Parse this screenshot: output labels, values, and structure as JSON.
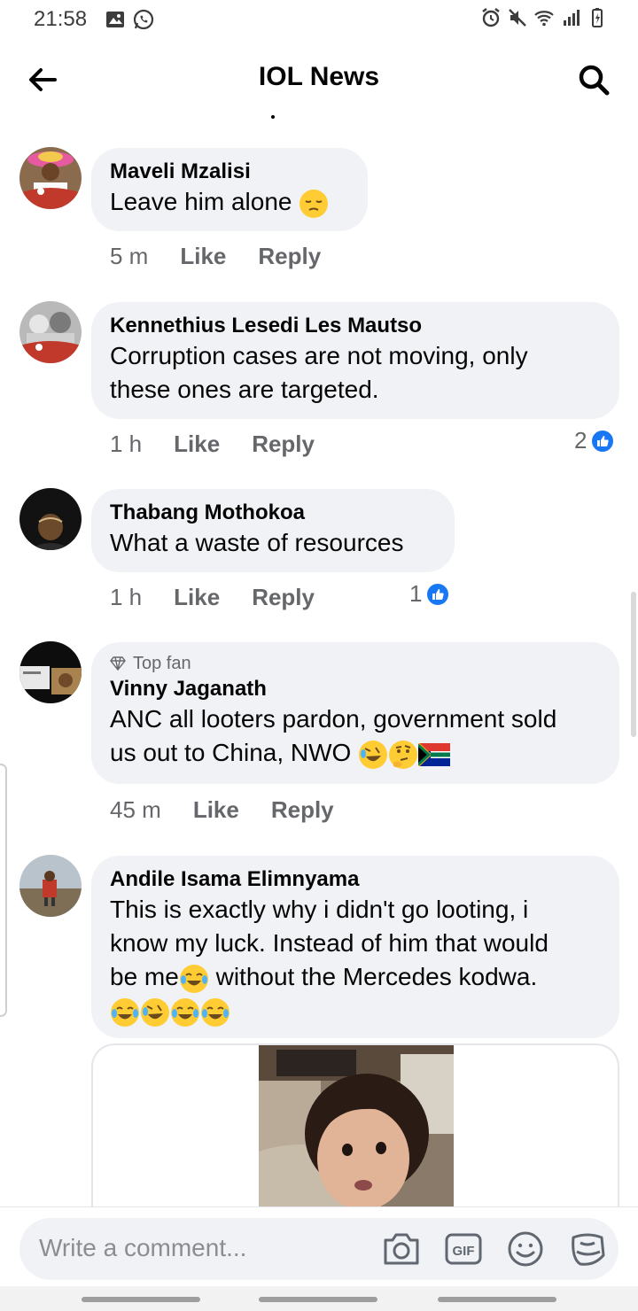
{
  "status_bar": {
    "time": "21:58"
  },
  "header": {
    "title": "IOL News"
  },
  "comments": [
    {
      "author": "Maveli Mzalisi",
      "text": "Leave him alone",
      "time": "5 m",
      "like": "Like",
      "reply": "Reply"
    },
    {
      "author": "Kennethius Lesedi Les Mautso",
      "text_line1": "Corruption cases are not moving, only",
      "text_line2": "these ones are targeted.",
      "time": "1 h",
      "like": "Like",
      "reply": "Reply",
      "reactions": "2"
    },
    {
      "author": "Thabang Mothokoa",
      "text": "What a waste of resources",
      "time": "1 h",
      "like": "Like",
      "reply": "Reply",
      "reactions": "1"
    },
    {
      "badge": "Top fan",
      "author": "Vinny Jaganath",
      "text_line1": "ANC all looters pardon, government sold",
      "text_line2": "us out to China, NWO",
      "time": "45 m",
      "like": "Like",
      "reply": "Reply"
    },
    {
      "author": "Andile Isama Elimnyama",
      "text_line1": "This is exactly why i didn't go looting, i",
      "text_line2": "know my luck. Instead of him that would",
      "text_line3a": "be me",
      "text_line3b": " without the Mercedes kodwa."
    }
  ],
  "composer": {
    "placeholder": "Write a comment..."
  },
  "icons": {
    "back": "arrow-left-icon",
    "search": "search-icon",
    "camera": "camera-icon",
    "gif": "gif-icon",
    "emoji": "smiley-icon",
    "sticker": "sticker-icon"
  },
  "colors": {
    "bubble": "#f0f2f5",
    "like_blue": "#1877f2",
    "meta_grey": "#65676b"
  }
}
